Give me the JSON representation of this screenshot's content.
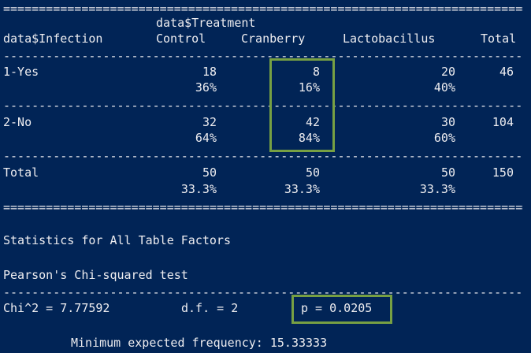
{
  "rules": {
    "double": "=======================================================================================",
    "single": "---------------------------------------------------------------------------------------"
  },
  "header": {
    "treatment_var": "data$Treatment",
    "infection_var": "data$Infection",
    "columns": [
      "Control",
      "Cranberry",
      "Lactobacillus",
      "Total"
    ]
  },
  "rows": [
    {
      "label": "1-Yes",
      "counts": [
        "18",
        "8",
        "20"
      ],
      "total": "46",
      "pcts": [
        "36%",
        "16%",
        "40%"
      ]
    },
    {
      "label": "2-No",
      "counts": [
        "32",
        "42",
        "30"
      ],
      "total": "104",
      "pcts": [
        "64%",
        "84%",
        "60%"
      ]
    },
    {
      "label": "Total",
      "counts": [
        "50",
        "50",
        "50"
      ],
      "total": "150",
      "pcts": [
        "33.3%",
        "33.3%",
        "33.3%"
      ]
    }
  ],
  "stats": {
    "heading": "Statistics for All Table Factors",
    "test_name": "Pearson's Chi-squared test",
    "chi": "Chi^2 = 7.77592",
    "df": "d.f. = 2",
    "p": "p = 0.0205",
    "min_expected": "Minimum expected frequency: 15.33333"
  },
  "highlight_color": "#77a043",
  "background_color": "#012456"
}
